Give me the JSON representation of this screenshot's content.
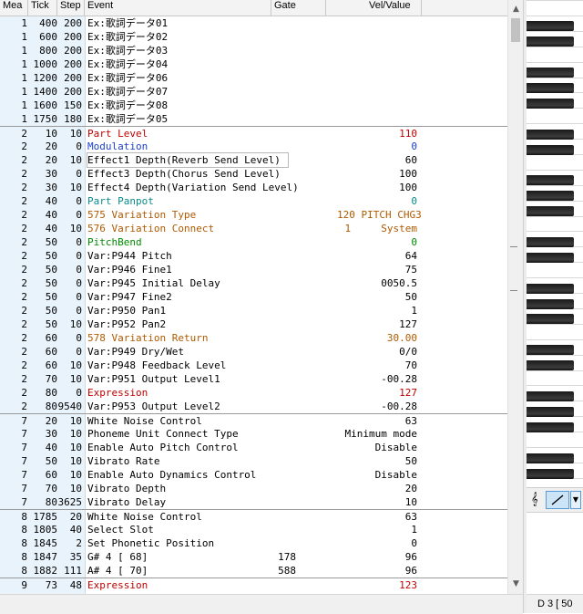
{
  "columns": {
    "mea": "Mea",
    "tick": "Tick",
    "step": "Step",
    "event": "Event",
    "gate": "Gate",
    "value": "Vel/Value"
  },
  "colors": {
    "red": "#c00000",
    "blue": "#1a3fc9",
    "teal": "#0a8a8a",
    "olive": "#b05a00",
    "green": "#008a00",
    "black": "#000000"
  },
  "rows": [
    {
      "mea": "1",
      "tick": "400",
      "step": "200",
      "event": "Ex:歌詞データ01",
      "gate": "",
      "value": "",
      "color": "black"
    },
    {
      "mea": "1",
      "tick": "600",
      "step": "200",
      "event": "Ex:歌詞データ02",
      "gate": "",
      "value": "",
      "color": "black"
    },
    {
      "mea": "1",
      "tick": "800",
      "step": "200",
      "event": "Ex:歌詞データ03",
      "gate": "",
      "value": "",
      "color": "black"
    },
    {
      "mea": "1",
      "tick": "1000",
      "step": "200",
      "event": "Ex:歌詞データ04",
      "gate": "",
      "value": "",
      "color": "black"
    },
    {
      "mea": "1",
      "tick": "1200",
      "step": "200",
      "event": "Ex:歌詞データ06",
      "gate": "",
      "value": "",
      "color": "black"
    },
    {
      "mea": "1",
      "tick": "1400",
      "step": "200",
      "event": "Ex:歌詞データ07",
      "gate": "",
      "value": "",
      "color": "black"
    },
    {
      "mea": "1",
      "tick": "1600",
      "step": "150",
      "event": "Ex:歌詞データ08",
      "gate": "",
      "value": "",
      "color": "black"
    },
    {
      "mea": "1",
      "tick": "1750",
      "step": "180",
      "event": "Ex:歌詞データ05",
      "gate": "",
      "value": "",
      "color": "black"
    },
    {
      "mea": "2",
      "tick": "10",
      "step": "10",
      "event": "Part Level",
      "gate": "",
      "value": "110",
      "color": "red",
      "sep": true
    },
    {
      "mea": "2",
      "tick": "20",
      "step": "0",
      "event": "Modulation",
      "gate": "",
      "value": "0",
      "color": "blue"
    },
    {
      "mea": "2",
      "tick": "20",
      "step": "10",
      "event": "Effect1 Depth(Reverb Send Level)",
      "gate": "",
      "value": "60",
      "color": "black",
      "boxed": true
    },
    {
      "mea": "2",
      "tick": "30",
      "step": "0",
      "event": "Effect3 Depth(Chorus Send Level)",
      "gate": "",
      "value": "100",
      "color": "black"
    },
    {
      "mea": "2",
      "tick": "30",
      "step": "10",
      "event": "Effect4 Depth(Variation Send Level)",
      "gate": "",
      "value": "100",
      "color": "black"
    },
    {
      "mea": "2",
      "tick": "40",
      "step": "0",
      "event": "Part Panpot",
      "gate": "",
      "value": "0",
      "color": "teal"
    },
    {
      "mea": "2",
      "tick": "40",
      "step": "0",
      "event": "575 Variation Type",
      "gate": "",
      "value": "120 PITCH CHG3",
      "color": "olive"
    },
    {
      "mea": "2",
      "tick": "40",
      "step": "10",
      "event": "576 Variation Connect",
      "gate": "",
      "value": "1     System",
      "color": "olive"
    },
    {
      "mea": "2",
      "tick": "50",
      "step": "0",
      "event": "PitchBend",
      "gate": "",
      "value": "0",
      "color": "green"
    },
    {
      "mea": "2",
      "tick": "50",
      "step": "0",
      "event": "Var:P944 Pitch",
      "gate": "",
      "value": "64",
      "color": "black"
    },
    {
      "mea": "2",
      "tick": "50",
      "step": "0",
      "event": "Var:P946 Fine1",
      "gate": "",
      "value": "75",
      "color": "black"
    },
    {
      "mea": "2",
      "tick": "50",
      "step": "0",
      "event": "Var:P945 Initial Delay",
      "gate": "",
      "value": "0050.5",
      "color": "black"
    },
    {
      "mea": "2",
      "tick": "50",
      "step": "0",
      "event": "Var:P947 Fine2",
      "gate": "",
      "value": "50",
      "color": "black"
    },
    {
      "mea": "2",
      "tick": "50",
      "step": "0",
      "event": "Var:P950 Pan1",
      "gate": "",
      "value": "1",
      "color": "black"
    },
    {
      "mea": "2",
      "tick": "50",
      "step": "10",
      "event": "Var:P952 Pan2",
      "gate": "",
      "value": "127",
      "color": "black"
    },
    {
      "mea": "2",
      "tick": "60",
      "step": "0",
      "event": "578 Variation Return",
      "gate": "",
      "value": "30.00",
      "color": "olive"
    },
    {
      "mea": "2",
      "tick": "60",
      "step": "0",
      "event": "Var:P949 Dry/Wet",
      "gate": "",
      "value": "0/0",
      "color": "black"
    },
    {
      "mea": "2",
      "tick": "60",
      "step": "10",
      "event": "Var:P948 Feedback Level",
      "gate": "",
      "value": "70",
      "color": "black"
    },
    {
      "mea": "2",
      "tick": "70",
      "step": "10",
      "event": "Var:P951 Output Level1",
      "gate": "",
      "value": "-00.28",
      "color": "black"
    },
    {
      "mea": "2",
      "tick": "80",
      "step": "0",
      "event": "Expression",
      "gate": "",
      "value": "127",
      "color": "red"
    },
    {
      "mea": "2",
      "tick": "80",
      "step": "9540",
      "event": "Var:P953 Output Level2",
      "gate": "",
      "value": "-00.28",
      "color": "black"
    },
    {
      "mea": "7",
      "tick": "20",
      "step": "10",
      "event": "White Noise Control",
      "gate": "",
      "value": "63",
      "color": "black",
      "sep": true
    },
    {
      "mea": "7",
      "tick": "30",
      "step": "10",
      "event": "Phoneme Unit Connect Type",
      "gate": "",
      "value": "Minimum mode",
      "color": "black"
    },
    {
      "mea": "7",
      "tick": "40",
      "step": "10",
      "event": "Enable Auto Pitch Control",
      "gate": "",
      "value": "Disable",
      "color": "black"
    },
    {
      "mea": "7",
      "tick": "50",
      "step": "10",
      "event": "Vibrato Rate",
      "gate": "",
      "value": "50",
      "color": "black"
    },
    {
      "mea": "7",
      "tick": "60",
      "step": "10",
      "event": "Enable Auto Dynamics Control",
      "gate": "",
      "value": "Disable",
      "color": "black"
    },
    {
      "mea": "7",
      "tick": "70",
      "step": "10",
      "event": "Vibrato Depth",
      "gate": "",
      "value": "20",
      "color": "black"
    },
    {
      "mea": "7",
      "tick": "80",
      "step": "3625",
      "event": "Vibrato Delay",
      "gate": "",
      "value": "10",
      "color": "black"
    },
    {
      "mea": "8",
      "tick": "1785",
      "step": "20",
      "event": "White Noise Control",
      "gate": "",
      "value": "63",
      "color": "black",
      "sep": true
    },
    {
      "mea": "8",
      "tick": "1805",
      "step": "40",
      "event": "Select Slot",
      "gate": "",
      "value": "1",
      "color": "black"
    },
    {
      "mea": "8",
      "tick": "1845",
      "step": "2",
      "event": "Set Phonetic Position",
      "gate": "",
      "value": "0",
      "color": "black"
    },
    {
      "mea": "8",
      "tick": "1847",
      "step": "35",
      "event": "G# 4 [ 68]",
      "gate": "178",
      "value": "96",
      "color": "black"
    },
    {
      "mea": "8",
      "tick": "1882",
      "step": "111",
      "event": "A# 4 [ 70]",
      "gate": "588",
      "value": "96",
      "color": "black"
    },
    {
      "mea": "9",
      "tick": "73",
      "step": "48",
      "event": "Expression",
      "gate": "",
      "value": "123",
      "color": "red",
      "sep": true
    }
  ],
  "scrollbar": {
    "up": "▲",
    "down": "▼"
  },
  "tools": {
    "clef": "𝄞",
    "dropdown": "▼",
    "pen_icon": "pencil-line-icon"
  },
  "status": {
    "text": "D 3 [ 50"
  }
}
